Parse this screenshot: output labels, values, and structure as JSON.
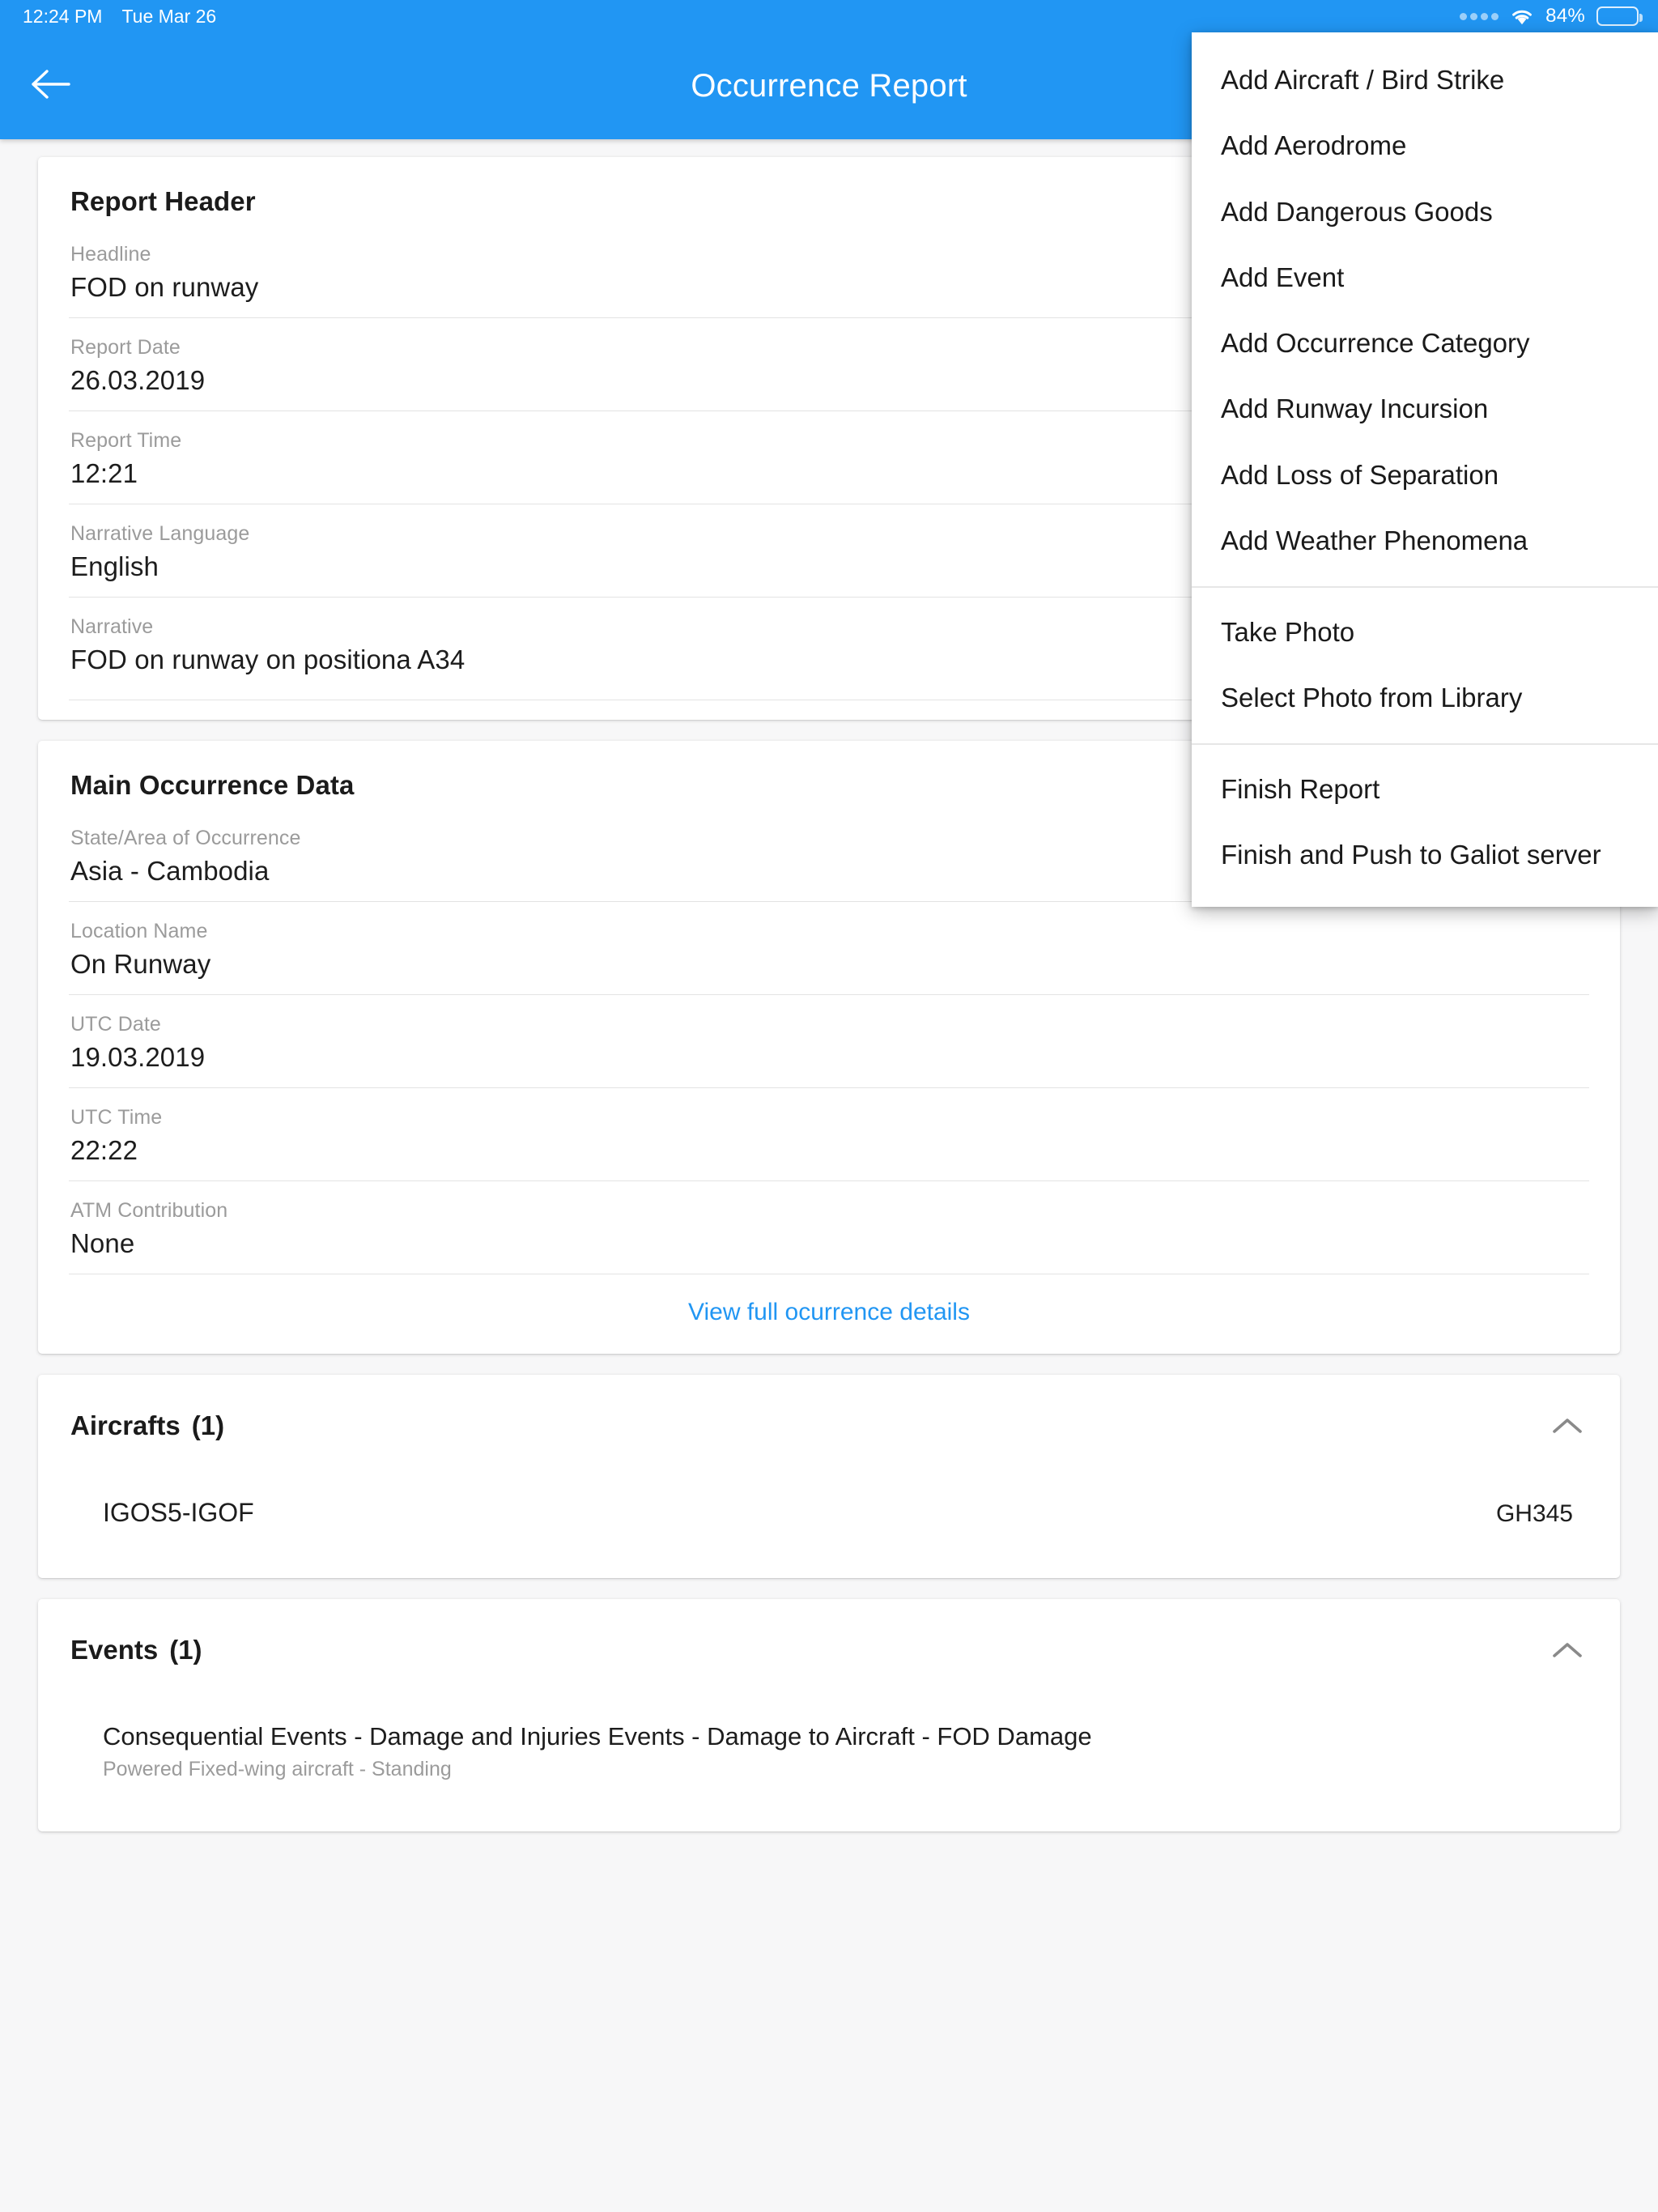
{
  "statusbar": {
    "time": "12:24 PM",
    "date": "Tue Mar 26",
    "battery_percent": "84%",
    "battery_level": 84,
    "wifi_icon": "wifi-icon",
    "signal_icon": "signal-dots-icon"
  },
  "appbar": {
    "title": "Occurrence Report",
    "back_icon": "back-arrow-icon"
  },
  "report_header": {
    "title": "Report Header",
    "fields": [
      {
        "label": "Headline",
        "value": "FOD on runway"
      },
      {
        "label": "Report Date",
        "value": "26.03.2019"
      },
      {
        "label": "Report Time",
        "value": "12:21"
      },
      {
        "label": "Narrative Language",
        "value": "English"
      },
      {
        "label": "Narrative",
        "value": "FOD on runway on positiona A34"
      }
    ]
  },
  "main_occurrence": {
    "title": "Main Occurrence Data",
    "fields": [
      {
        "label": "State/Area of Occurrence",
        "value": "Asia - Cambodia"
      },
      {
        "label": "Location Name",
        "value": "On Runway"
      },
      {
        "label": "UTC Date",
        "value": "19.03.2019"
      },
      {
        "label": "UTC Time",
        "value": "22:22"
      },
      {
        "label": "ATM Contribution",
        "value": "None"
      }
    ],
    "link": "View full ocurrence details"
  },
  "aircrafts": {
    "title": "Aircrafts",
    "count": "(1)",
    "collapse_icon": "chevron-up-icon",
    "rows": [
      {
        "registration": "IGOS5-IGOF",
        "flight": "GH345"
      }
    ]
  },
  "events": {
    "title": "Events",
    "count": "(1)",
    "collapse_icon": "chevron-up-icon",
    "rows": [
      {
        "title": "Consequential Events - Damage and Injuries Events - Damage to Aircraft - FOD Damage",
        "subtitle": "Powered Fixed-wing aircraft - Standing"
      }
    ]
  },
  "menu": {
    "groups": [
      {
        "items": [
          "Add Aircraft / Bird Strike",
          "Add Aerodrome",
          "Add Dangerous Goods",
          "Add Event",
          "Add Occurrence Category",
          "Add Runway Incursion",
          "Add Loss of Separation",
          "Add Weather Phenomena"
        ]
      },
      {
        "items": [
          "Take Photo",
          "Select Photo from Library"
        ]
      },
      {
        "items": [
          "Finish Report",
          "Finish and Push to Galiot server"
        ]
      }
    ]
  },
  "colors": {
    "accent": "#2196f3",
    "page_bg": "#f7f7f8",
    "card_bg": "#ffffff",
    "label": "#9b9b9b",
    "value": "#1d1d1d"
  }
}
